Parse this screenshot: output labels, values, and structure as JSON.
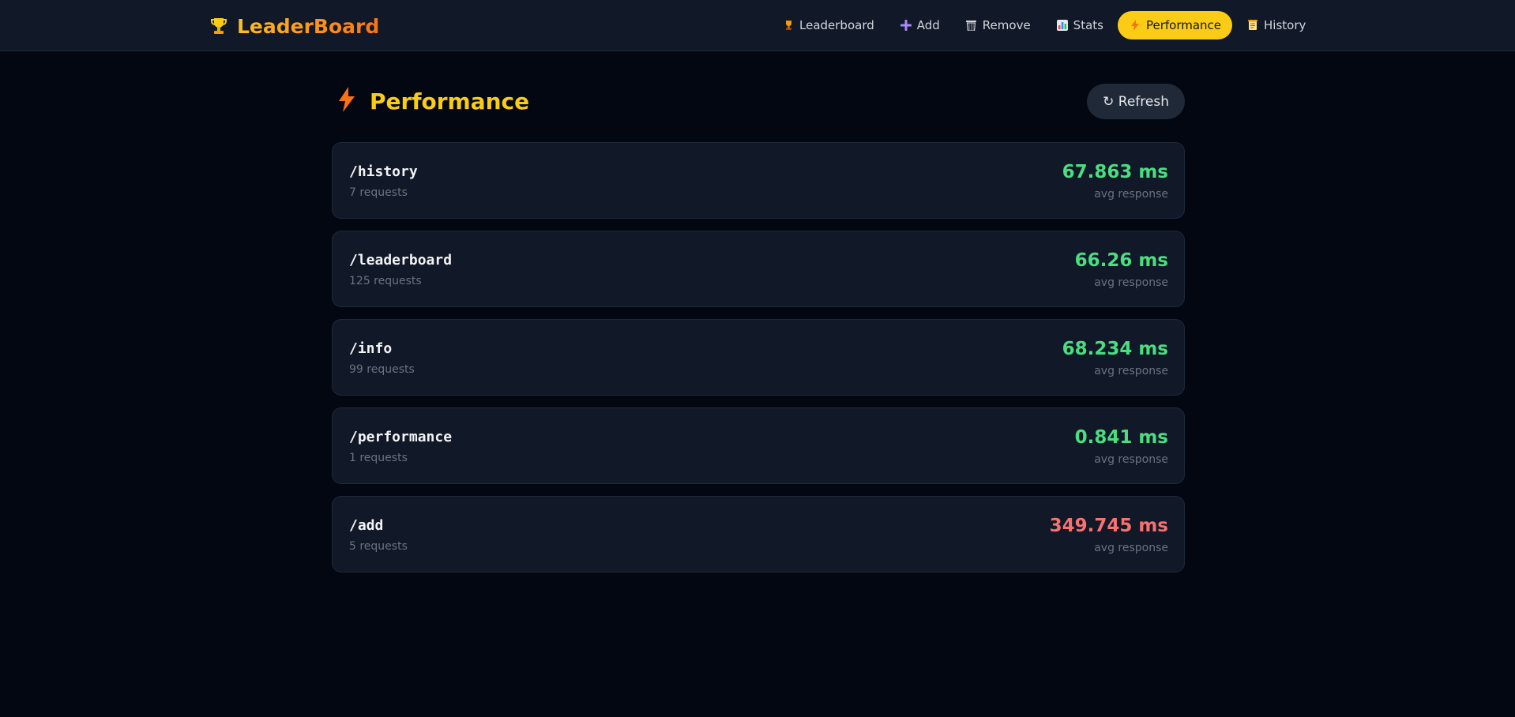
{
  "brand": {
    "name": "LeaderBoard",
    "icon": "trophy-icon"
  },
  "nav": [
    {
      "label": "Leaderboard",
      "icon": "trophy-icon",
      "active": false
    },
    {
      "label": "Add",
      "icon": "plus-icon",
      "active": false
    },
    {
      "label": "Remove",
      "icon": "trash-icon",
      "active": false
    },
    {
      "label": "Stats",
      "icon": "bar-chart-icon",
      "active": false
    },
    {
      "label": "Performance",
      "icon": "lightning-icon",
      "active": true
    },
    {
      "label": "History",
      "icon": "scroll-icon",
      "active": false
    }
  ],
  "page": {
    "title": "Performance",
    "title_icon": "lightning-icon",
    "refresh_label": "↻ Refresh"
  },
  "endpoints": [
    {
      "path": "/history",
      "requests": "7 requests",
      "avg": "67.863 ms",
      "avg_label": "avg response",
      "status_color": "#4ade80"
    },
    {
      "path": "/leaderboard",
      "requests": "125 requests",
      "avg": "66.26 ms",
      "avg_label": "avg response",
      "status_color": "#4ade80"
    },
    {
      "path": "/info",
      "requests": "99 requests",
      "avg": "68.234 ms",
      "avg_label": "avg response",
      "status_color": "#4ade80"
    },
    {
      "path": "/performance",
      "requests": "1 requests",
      "avg": "0.841 ms",
      "avg_label": "avg response",
      "status_color": "#4ade80"
    },
    {
      "path": "/add",
      "requests": "5 requests",
      "avg": "349.745 ms",
      "avg_label": "avg response",
      "status_color": "#f87171"
    }
  ],
  "colors": {
    "accent": "#facc15",
    "good": "#4ade80",
    "slow": "#f87171",
    "background": "#030712",
    "card": "#111827"
  }
}
